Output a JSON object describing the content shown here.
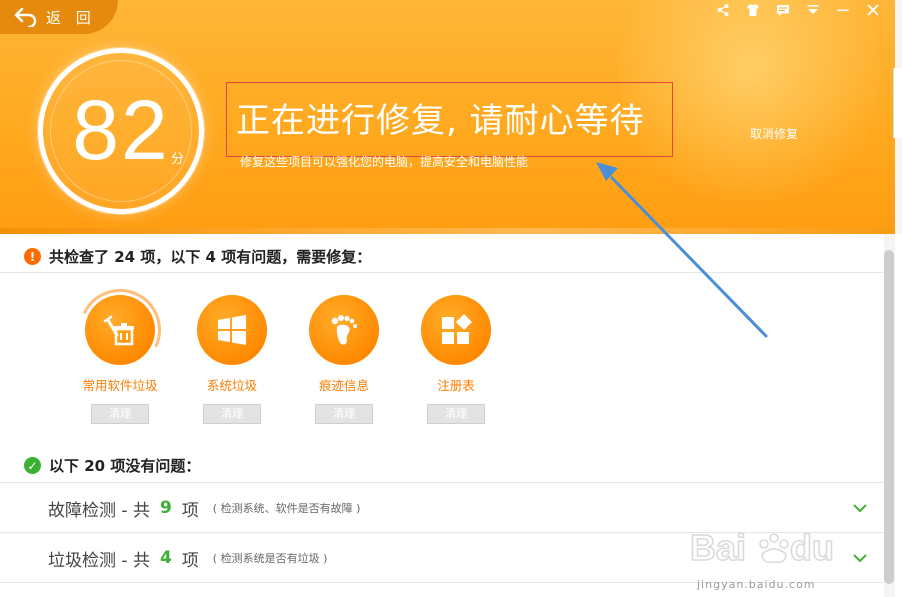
{
  "header": {
    "back_label": "返 回",
    "score": "82",
    "score_unit": "分",
    "title": "正在进行修复, 请耐心等待",
    "subtitle": "修复这些项目可以强化您的电脑，提高安全和电脑性能",
    "cancel_label": "取消修复",
    "top_icons": [
      "share-icon",
      "shirt-icon",
      "message-icon",
      "menu-icon",
      "minimize-icon",
      "close-icon"
    ]
  },
  "problems": {
    "heading": "共检查了 24 项，以下 4 项有问题，需要修复：",
    "items": [
      {
        "label": "常用软件垃圾",
        "button": "清理",
        "icon": "software-trash-icon"
      },
      {
        "label": "系统垃圾",
        "button": "清理",
        "icon": "windows-icon"
      },
      {
        "label": "痕迹信息",
        "button": "清理",
        "icon": "footprint-icon"
      },
      {
        "label": "注册表",
        "button": "清理",
        "icon": "registry-icon"
      }
    ]
  },
  "ok_section": {
    "heading": "以下 20 项没有问题：",
    "rows": [
      {
        "name": "故障检测 - 共",
        "count": "9",
        "unit": "项",
        "desc": "( 检测系统、软件是否有故障 )"
      },
      {
        "name": "垃圾检测 - 共",
        "count": "4",
        "unit": "项",
        "desc": "( 检测系统是否有垃圾 )"
      }
    ]
  },
  "watermark": {
    "text": "jingyan.baidu.com"
  },
  "colors": {
    "orange": "#ffa91f",
    "item_orange": "#ff8a00",
    "green": "#3cb034",
    "annotation_red": "#e8453c",
    "annotation_blue": "#4a90d9"
  }
}
